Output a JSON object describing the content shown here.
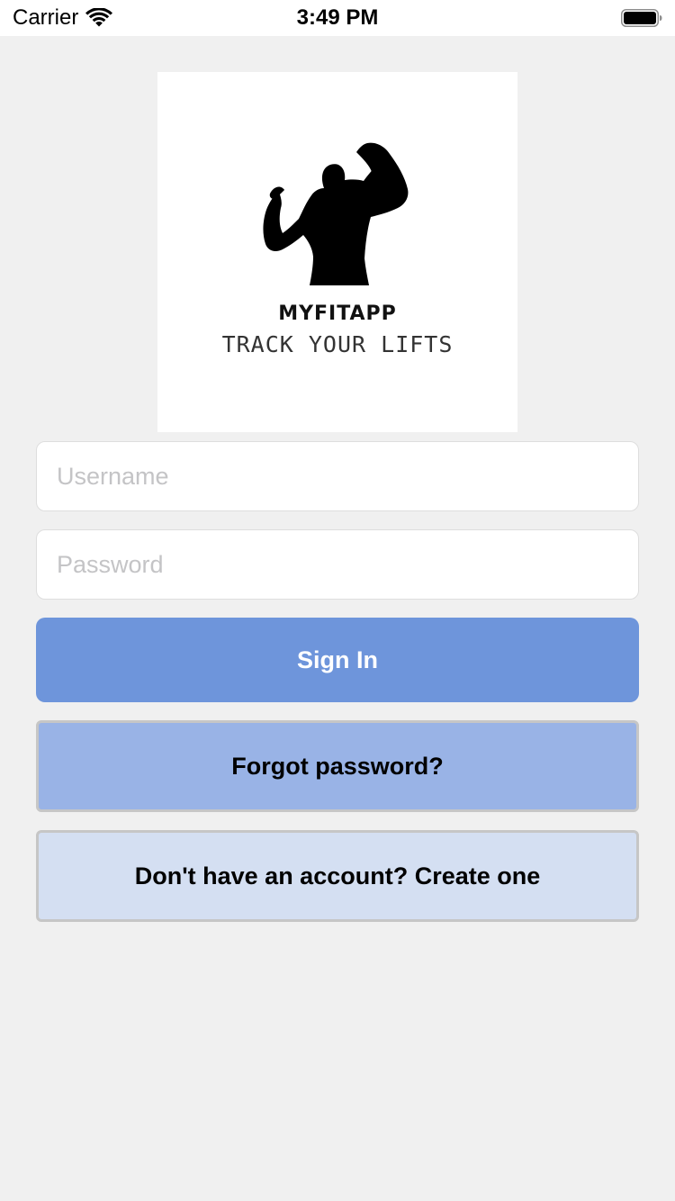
{
  "status_bar": {
    "carrier": "Carrier",
    "time": "3:49 PM",
    "icons": [
      "wifi-icon",
      "battery-icon"
    ]
  },
  "logo": {
    "icon": "flexing-bodybuilder-silhouette",
    "title": "MYFITAPP",
    "subtitle": "TRACK YOUR LIFTS"
  },
  "form": {
    "username_placeholder": "Username",
    "username_value": "",
    "password_placeholder": "Password",
    "password_value": ""
  },
  "buttons": {
    "sign_in": "Sign In",
    "forgot_password": "Forgot password?",
    "create_account": "Don't have an account? Create one"
  },
  "colors": {
    "background": "#f0f0f0",
    "sign_in_button": "#6e95db",
    "forgot_button": "#99b3e6",
    "create_button": "#d4dff2"
  }
}
